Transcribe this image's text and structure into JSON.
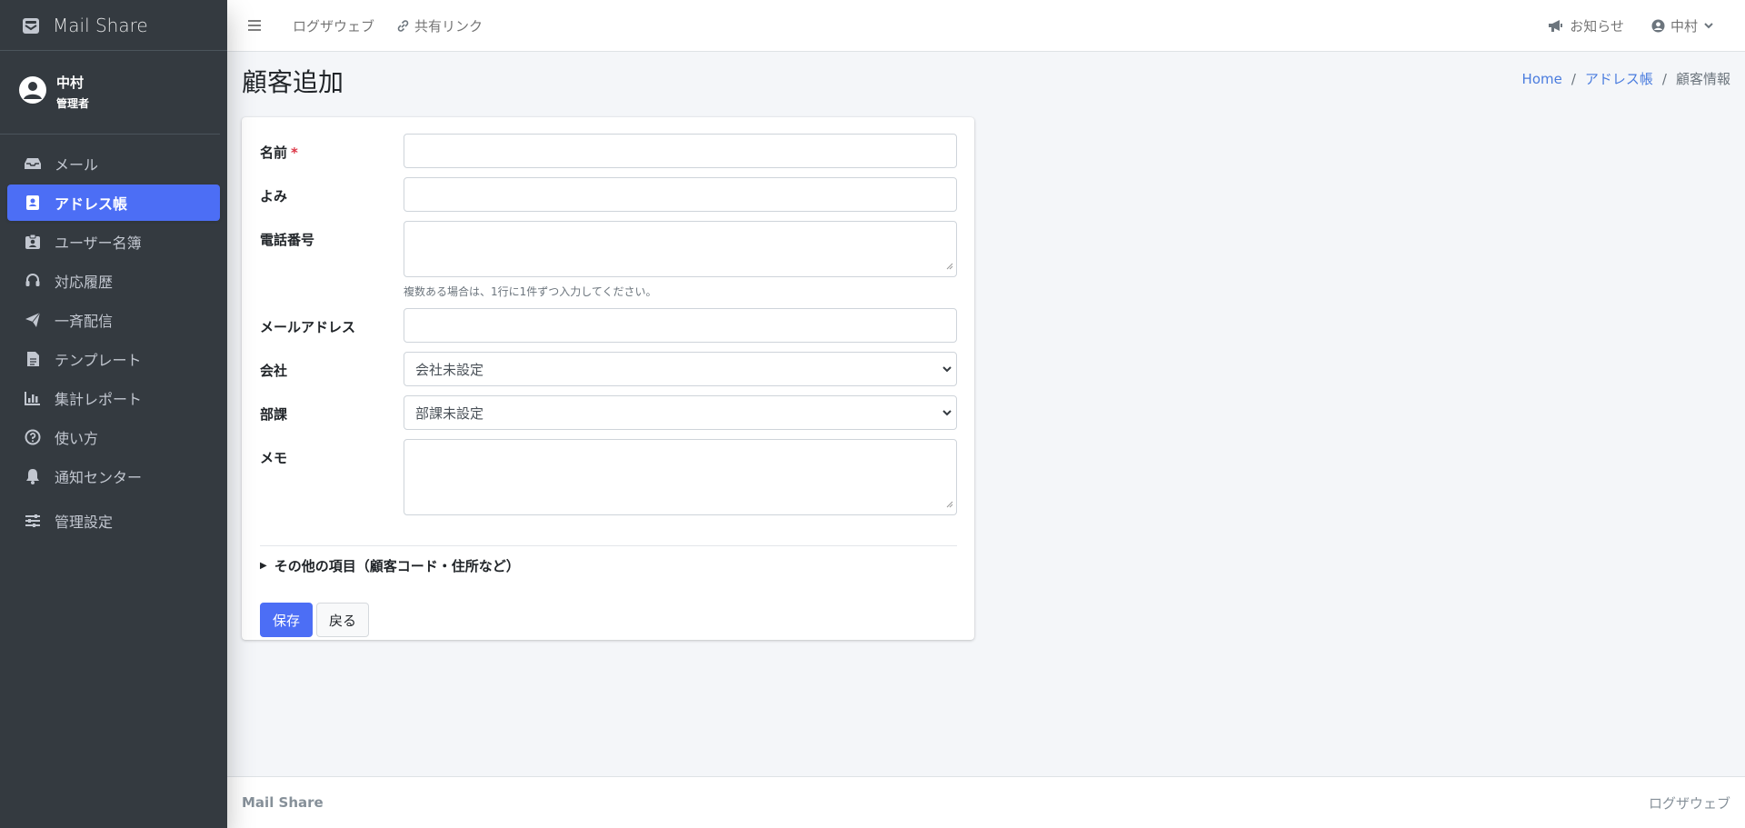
{
  "sidebar": {
    "brand": "Mail Share",
    "user": {
      "name": "中村",
      "role": "管理者"
    },
    "items": [
      {
        "label": "メール",
        "icon": "inbox-icon"
      },
      {
        "label": "アドレス帳",
        "icon": "address-book-icon",
        "active": true
      },
      {
        "label": "ユーザー名簿",
        "icon": "id-badge-icon"
      },
      {
        "label": "対応履歴",
        "icon": "headset-icon"
      },
      {
        "label": "一斉配信",
        "icon": "paper-plane-icon"
      },
      {
        "label": "テンプレート",
        "icon": "file-icon"
      },
      {
        "label": "集計レポート",
        "icon": "bar-chart-icon"
      },
      {
        "label": "使い方",
        "icon": "question-circle-icon"
      },
      {
        "label": "通知センター",
        "icon": "bell-icon"
      },
      {
        "label": "管理設定",
        "icon": "sliders-icon"
      }
    ]
  },
  "topbar": {
    "links": [
      "ログザウェブ",
      "共有リンク"
    ],
    "notice": "お知らせ",
    "user": "中村"
  },
  "page": {
    "title": "顧客追加",
    "breadcrumb": [
      "Home",
      "アドレス帳",
      "顧客情報"
    ]
  },
  "form": {
    "name_label": "名前",
    "required_mark": "*",
    "yomi_label": "よみ",
    "phone_label": "電話番号",
    "phone_help": "複数ある場合は、1行に1件ずつ入力してください。",
    "email_label": "メールアドレス",
    "company_label": "会社",
    "company_value": "会社未設定",
    "dept_label": "部課",
    "dept_value": "部課未設定",
    "memo_label": "メモ",
    "more_toggle": "その他の項目（顧客コード・住所など）",
    "save_label": "保存",
    "back_label": "戻る"
  },
  "footer": {
    "left": "Mail Share",
    "right": "ログザウェブ"
  },
  "colors": {
    "sidebar_bg": "#343a40",
    "accent": "#4c6ef5",
    "link": "#4a7cde",
    "required": "#dc3545"
  }
}
